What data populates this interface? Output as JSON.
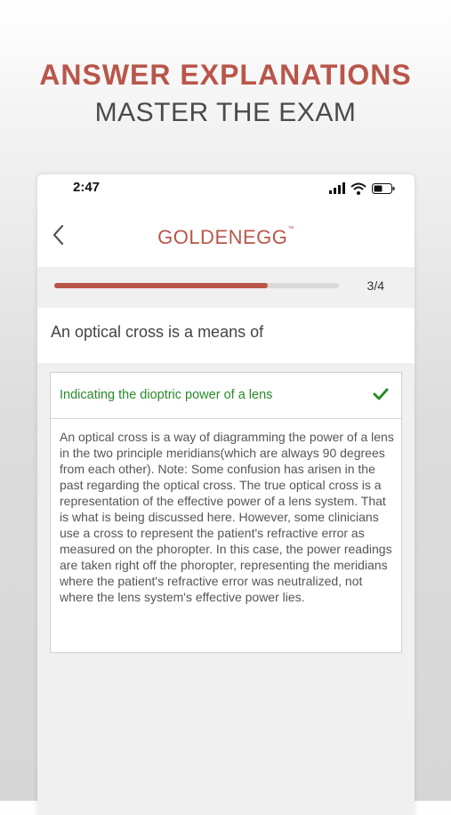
{
  "promo": {
    "headline": "ANSWER EXPLANATIONS",
    "subheadline": "MASTER THE EXAM"
  },
  "status_bar": {
    "time": "2:47",
    "icons": [
      "signal-icon",
      "wifi-icon",
      "battery-icon"
    ]
  },
  "nav": {
    "back_icon": "chevron-left-icon",
    "logo_main": "GOLDENEGG",
    "logo_tm": "™"
  },
  "progress": {
    "count_label": "3/4",
    "fraction": 0.75
  },
  "question": {
    "text": "An optical cross is a means of"
  },
  "answer": {
    "text": "Indicating the dioptric power of a lens",
    "status_icon": "check-icon",
    "explanation": "An optical cross is a way of diagramming the power of a lens in the two principle meridians(which are always 90 degrees from each other). Note: Some confusion has arisen in the past regarding the optical cross. The true optical cross is a representation of the effective power of a lens system. That is what is being discussed here. However, some clinicians use a cross to represent the patient's refractive error as measured on the phoropter. In this case, the power readings are taken right off the phoropter, representing the meridians where the patient's refractive error was neutralized, not where the lens system's effective power lies."
  },
  "colors": {
    "brand": "#b9564a",
    "correct": "#2a8a2a",
    "track": "#d9d9d9"
  }
}
